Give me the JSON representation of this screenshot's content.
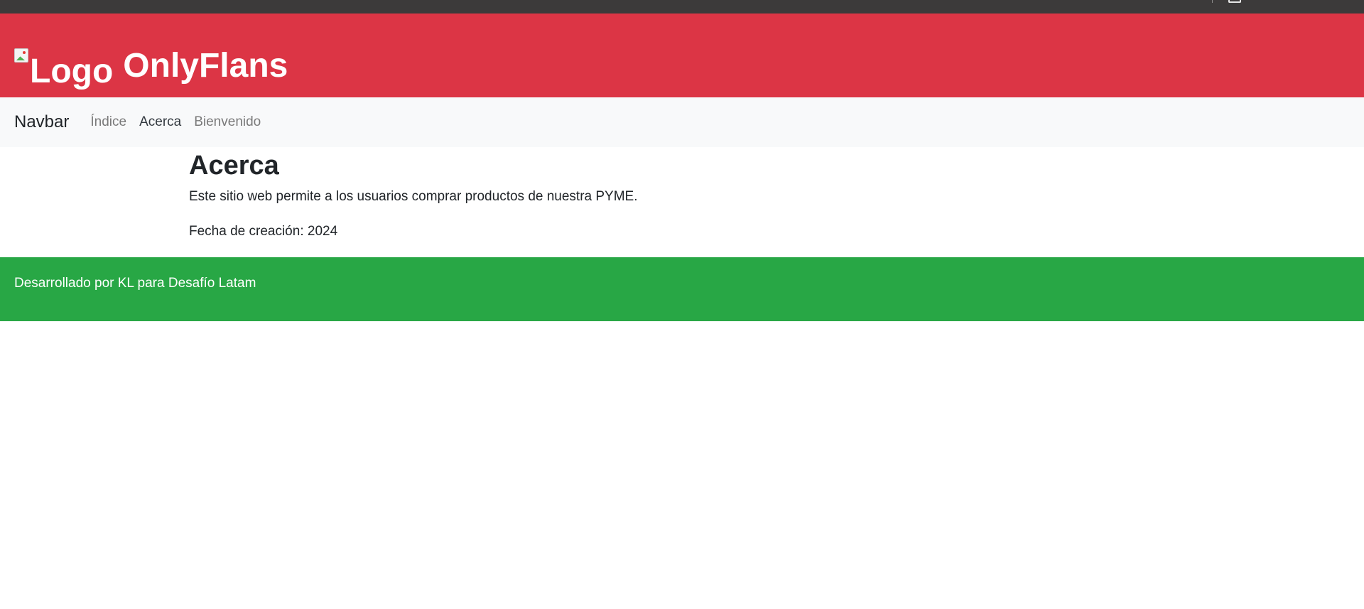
{
  "site": {
    "logo_alt": "Logo",
    "title": "OnlyFlans"
  },
  "navbar": {
    "brand": "Navbar",
    "links": [
      {
        "label": "Índice",
        "active": false
      },
      {
        "label": "Acerca",
        "active": true
      },
      {
        "label": "Bienvenido",
        "active": false
      }
    ]
  },
  "main": {
    "heading": "Acerca",
    "description": "Este sitio web permite a los usuarios comprar productos de nuestra PYME.",
    "creation_date": "Fecha de creación: 2024"
  },
  "footer": {
    "text": "Desarrollado por KL para Desafío Latam"
  },
  "colors": {
    "header_bg": "#dc3545",
    "navbar_bg": "#f8f9fa",
    "footer_bg": "#28a745",
    "topbar_bg": "#3c3a3a"
  },
  "icons": {
    "broken_image": "broken-image-icon"
  }
}
